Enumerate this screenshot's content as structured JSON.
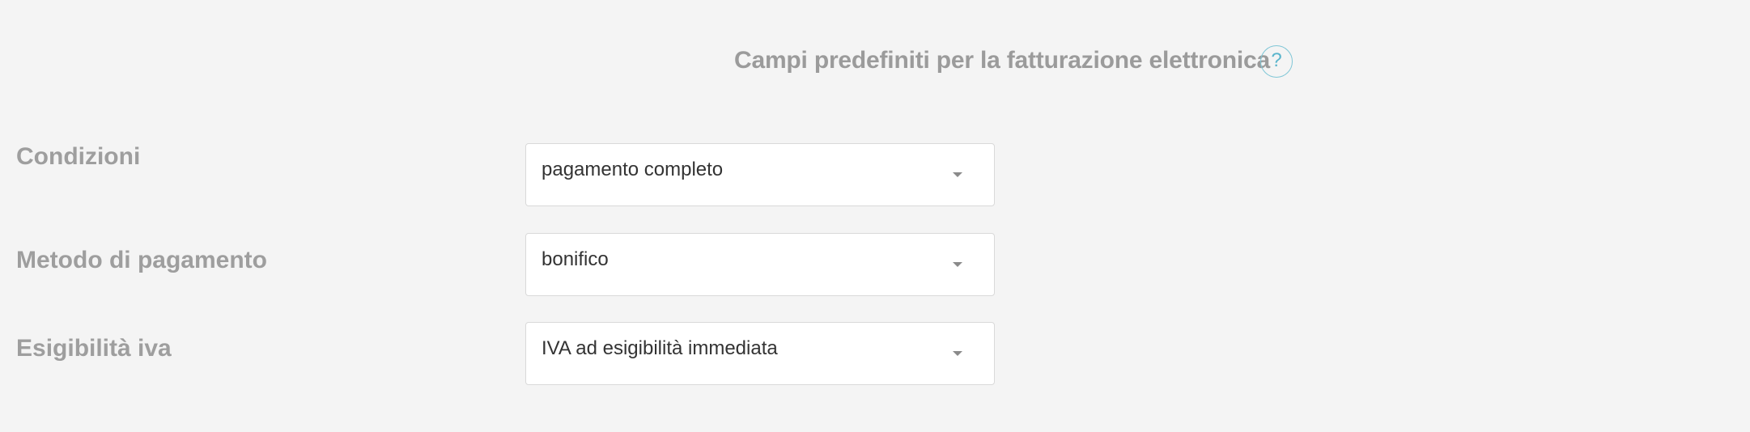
{
  "header": {
    "title": "Campi predefiniti per la fatturazione elettronica",
    "help_icon": "question-icon",
    "help_glyph": "?"
  },
  "fields": [
    {
      "label": "Condizioni",
      "value": "pagamento completo",
      "icon": "caret-down-icon"
    },
    {
      "label": "Metodo di pagamento",
      "value": "bonifico",
      "icon": "caret-down-icon"
    },
    {
      "label": "Esigibilità iva",
      "value": "IVA ad esigibilità immediata",
      "icon": "caret-down-icon"
    }
  ],
  "colors": {
    "background": "#f4f4f4",
    "label": "#9e9e9e",
    "help_accent": "#5bb5cc",
    "select_border": "#d9d9d9",
    "select_text": "#333333"
  }
}
